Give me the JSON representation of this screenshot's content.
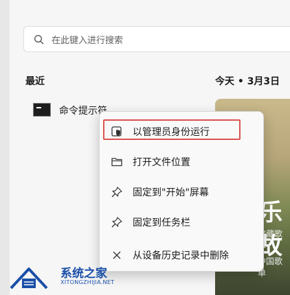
{
  "search": {
    "placeholder": "在此键入进行搜索",
    "icon": "search-icon"
  },
  "recent": {
    "title": "最近",
    "items": [
      {
        "label": "命令提示符",
        "icon": "terminal-icon"
      }
    ]
  },
  "highlights": {
    "date": "今天 • 3月3日",
    "card": {
      "title": "乐故",
      "line1": "宝藏歌单",
      "line2": "中国歌单"
    }
  },
  "context_menu": {
    "items": [
      {
        "label": "以管理员身份运行",
        "icon": "admin-shield-icon",
        "highlighted": true
      },
      {
        "label": "打开文件位置",
        "icon": "folder-icon"
      },
      {
        "label": "固定到\"开始\"屏幕",
        "icon": "pin-icon"
      },
      {
        "label": "固定到任务栏",
        "icon": "pin-icon"
      },
      {
        "label": "从设备历史记录中删除",
        "icon": "close-icon"
      }
    ]
  },
  "watermark": {
    "name": "系统之家",
    "url": "XITONGZHIJIA.NET"
  },
  "colors": {
    "highlight_border": "#d9534f",
    "logo_blue": "#1a4fa8"
  }
}
